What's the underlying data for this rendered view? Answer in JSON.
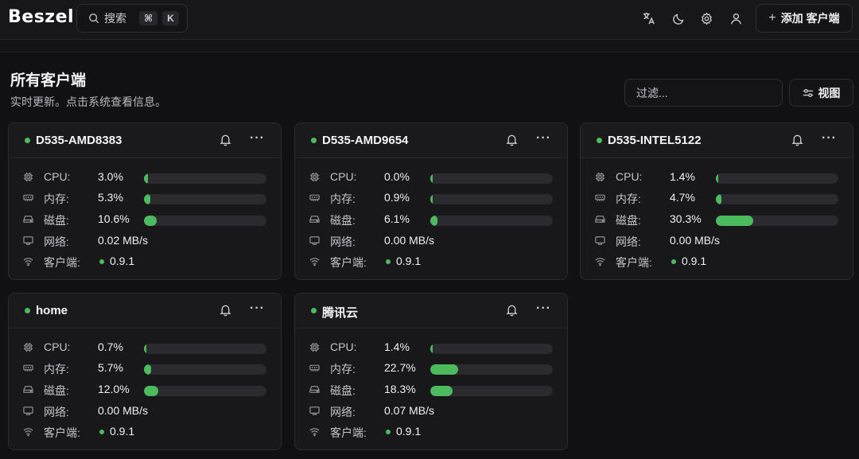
{
  "app": {
    "logo": "Beszel"
  },
  "header": {
    "search_label": "搜索",
    "kbd": [
      "⌘",
      "K"
    ],
    "add_label": "添加 客户端",
    "icons": [
      "translate-icon",
      "moon-icon",
      "gear-icon",
      "user-icon"
    ]
  },
  "page": {
    "title": "所有客户端",
    "subtitle": "实时更新。点击系统查看信息。",
    "filter_placeholder": "过滤...",
    "view_label": "视图"
  },
  "labels": {
    "cpu": "CPU:",
    "mem": "内存:",
    "disk": "磁盘:",
    "net": "网络:",
    "agent": "客户端:"
  },
  "colors": {
    "status": "#4cbb5e",
    "bar": "#4cbb5e"
  },
  "systems": [
    {
      "name": "D535-AMD8383",
      "cpu": "3.0%",
      "cpu_pct": 3.0,
      "mem": "5.3%",
      "mem_pct": 5.3,
      "disk": "10.6%",
      "disk_pct": 10.6,
      "net": "0.02 MB/s",
      "version": "0.9.1"
    },
    {
      "name": "D535-AMD9654",
      "cpu": "0.0%",
      "cpu_pct": 0.0,
      "mem": "0.9%",
      "mem_pct": 0.9,
      "disk": "6.1%",
      "disk_pct": 6.1,
      "net": "0.00 MB/s",
      "version": "0.9.1"
    },
    {
      "name": "D535-INTEL5122",
      "cpu": "1.4%",
      "cpu_pct": 1.4,
      "mem": "4.7%",
      "mem_pct": 4.7,
      "disk": "30.3%",
      "disk_pct": 30.3,
      "net": "0.00 MB/s",
      "version": "0.9.1"
    },
    {
      "name": "home",
      "cpu": "0.7%",
      "cpu_pct": 0.7,
      "mem": "5.7%",
      "mem_pct": 5.7,
      "disk": "12.0%",
      "disk_pct": 12.0,
      "net": "0.00 MB/s",
      "version": "0.9.1"
    },
    {
      "name": "腾讯云",
      "cpu": "1.4%",
      "cpu_pct": 1.4,
      "mem": "22.7%",
      "mem_pct": 22.7,
      "disk": "18.3%",
      "disk_pct": 18.3,
      "net": "0.07 MB/s",
      "version": "0.9.1"
    }
  ]
}
